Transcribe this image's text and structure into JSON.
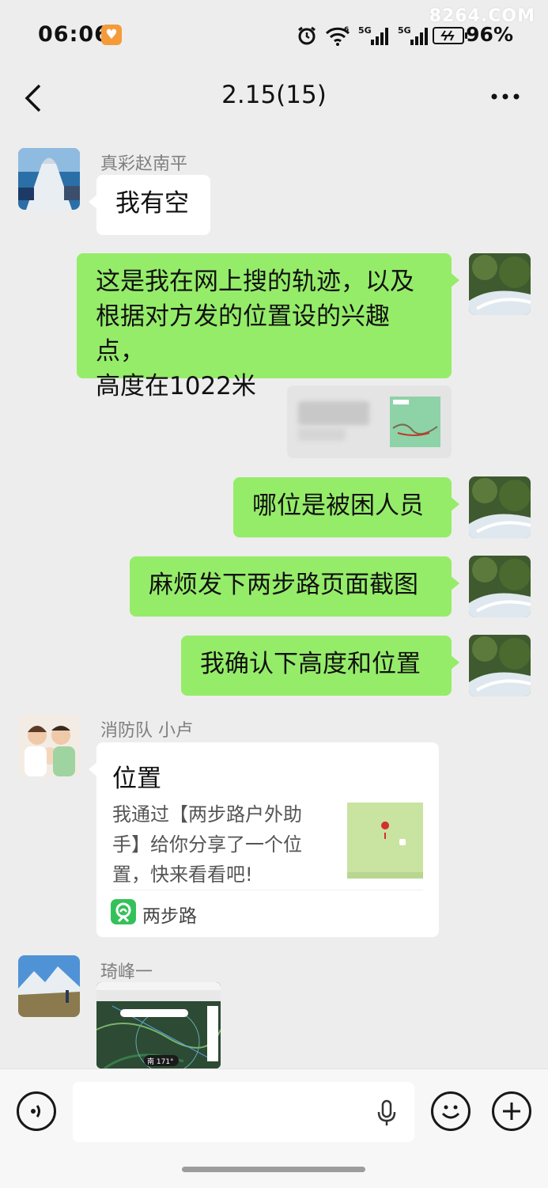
{
  "status_bar": {
    "time": "06:06",
    "battery_percent": "96%",
    "watermark": "8264.COM",
    "network_1": "5G",
    "network_2": "5G",
    "wifi_tag": "6"
  },
  "header": {
    "title": "2.15(15)",
    "back_icon": "chevron-left-icon",
    "more_icon": "more-dots-icon"
  },
  "messages": [
    {
      "sender": "真彩赵南平",
      "text": "我有空"
    },
    {
      "text": "这是我在网上搜的轨迹，以及根据对方发的位置设的兴趣点，高度在1022米",
      "lines": [
        "这是我在网上搜的轨迹，以及",
        "根据对方发的位置设的兴趣点，",
        "高度在1022米"
      ]
    },
    {
      "text": "哪位是被困人员"
    },
    {
      "text": "麻烦发下两步路页面截图"
    },
    {
      "text": "我确认下高度和位置"
    },
    {
      "sender": "消防队 小卢",
      "card": {
        "title": "位置",
        "desc": "我通过【两步路户外助手】给你分享了一个位置，快来看看吧!",
        "desc_lines": [
          "我通过【两步路户外助",
          "手】给你分享了一个位",
          "置，快来看看吧!"
        ],
        "app": "两步路"
      }
    },
    {
      "sender": "琦峰一",
      "image": {
        "compass": "南 171°"
      }
    }
  ],
  "input_bar": {
    "voice_icon": "voice-icon",
    "mic_icon": "microphone-icon",
    "emoji_icon": "emoji-icon",
    "plus_icon": "plus-icon"
  },
  "colors": {
    "background": "#ededed",
    "outgoing_bubble": "#95ec69",
    "incoming_bubble": "#ffffff"
  }
}
